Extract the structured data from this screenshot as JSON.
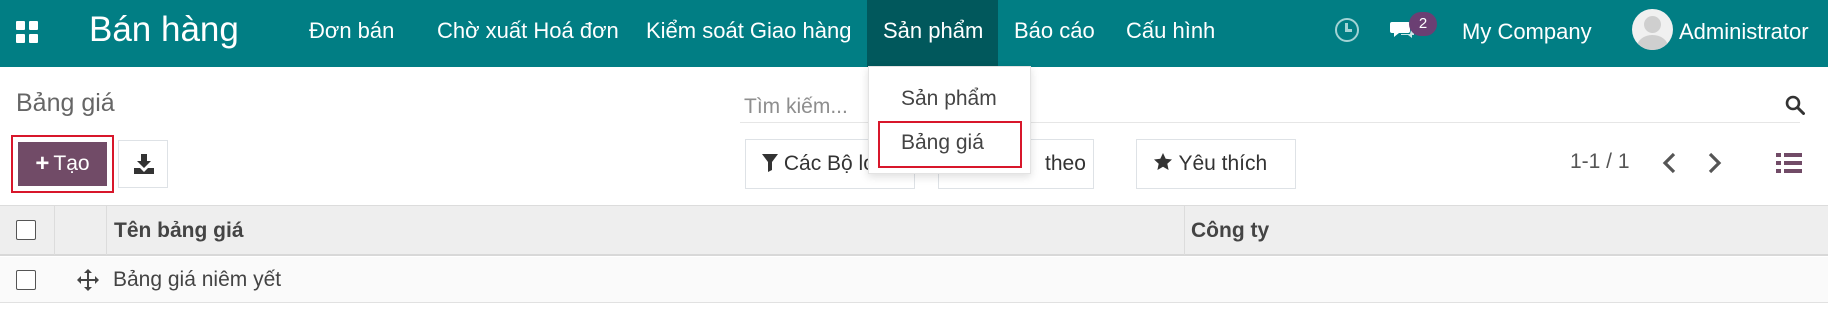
{
  "navbar": {
    "app_name": "Bán hàng",
    "menu": [
      {
        "label": "Đơn bán"
      },
      {
        "label": "Chờ xuất Hoá đơn"
      },
      {
        "label": "Kiểm soát Giao hàng"
      },
      {
        "label": "Sản phẩm"
      },
      {
        "label": "Báo cáo"
      },
      {
        "label": "Cấu hình"
      }
    ],
    "messages_badge": "2",
    "company": "My Company",
    "user": "Administrator",
    "accent_color": "#017e84",
    "active_menu_color": "#01585c"
  },
  "dropdown": {
    "items": [
      {
        "label": "Sản phẩm"
      },
      {
        "label": "Bảng giá"
      }
    ]
  },
  "control_panel": {
    "breadcrumb": "Bảng giá",
    "search_placeholder": "Tìm kiếm...",
    "create_label": "Tạo",
    "filters_label": "Các Bộ lọc",
    "group_by_label": "theo",
    "favorites_label": "Yêu thích",
    "pager": "1-1 / 1",
    "primary_color": "#714b67"
  },
  "table": {
    "columns": [
      "Tên bảng giá",
      "Công ty"
    ],
    "rows": [
      {
        "name": "Bảng giá niêm yết",
        "company": ""
      }
    ]
  },
  "icons": {
    "apps": "apps-grid-icon",
    "activity": "clock-icon",
    "messages": "chat-icon",
    "search": "search-icon",
    "download": "download-icon",
    "filter": "filter-icon",
    "favorite": "star-icon",
    "pager_prev": "chevron-left-icon",
    "pager_next": "chevron-right-icon",
    "list_view": "list-view-icon",
    "handle": "drag-handle-icon"
  }
}
